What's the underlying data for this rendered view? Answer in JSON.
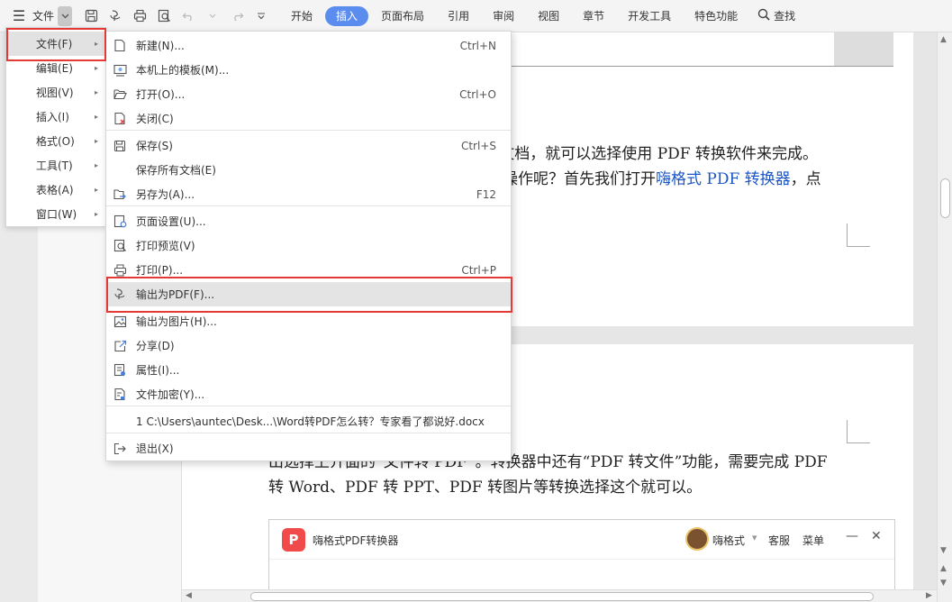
{
  "toolbar": {
    "file_label": "文件",
    "tabs": [
      {
        "label": "开始",
        "active": false
      },
      {
        "label": "插入",
        "active": true
      },
      {
        "label": "页面布局",
        "active": false
      },
      {
        "label": "引用",
        "active": false
      },
      {
        "label": "审阅",
        "active": false
      },
      {
        "label": "视图",
        "active": false
      },
      {
        "label": "章节",
        "active": false
      },
      {
        "label": "开发工具",
        "active": false
      },
      {
        "label": "特色功能",
        "active": false
      }
    ],
    "search_label": "查找",
    "accent_color": "#5b8def"
  },
  "main_menu": {
    "items": [
      {
        "label": "文件(F)",
        "highlighted": true
      },
      {
        "label": "编辑(E)"
      },
      {
        "label": "视图(V)"
      },
      {
        "label": "插入(I)"
      },
      {
        "label": "格式(O)"
      },
      {
        "label": "工具(T)"
      },
      {
        "label": "表格(A)"
      },
      {
        "label": "窗口(W)"
      }
    ]
  },
  "file_submenu": {
    "items": [
      {
        "label": "新建(N)...",
        "shortcut": "Ctrl+N",
        "icon": "new-doc-icon"
      },
      {
        "label": "本机上的模板(M)...",
        "shortcut": "",
        "icon": "template-icon"
      },
      {
        "label": "打开(O)...",
        "shortcut": "Ctrl+O",
        "icon": "folder-open-icon"
      },
      {
        "label": "关闭(C)",
        "shortcut": "",
        "icon": "close-doc-icon"
      },
      {
        "label": "保存(S)",
        "shortcut": "Ctrl+S",
        "icon": "save-icon"
      },
      {
        "label": "保存所有文档(E)",
        "shortcut": "",
        "icon": ""
      },
      {
        "label": "另存为(A)...",
        "shortcut": "F12",
        "icon": "save-as-icon"
      },
      {
        "label": "页面设置(U)...",
        "shortcut": "",
        "icon": "page-setup-icon"
      },
      {
        "label": "打印预览(V)",
        "shortcut": "",
        "icon": "print-preview-icon"
      },
      {
        "label": "打印(P)...",
        "shortcut": "Ctrl+P",
        "icon": "printer-icon"
      },
      {
        "label": "输出为PDF(F)...",
        "shortcut": "",
        "icon": "export-pdf-icon",
        "highlighted": true
      },
      {
        "label": "输出为图片(H)...",
        "shortcut": "",
        "icon": "export-image-icon"
      },
      {
        "label": "分享(D)",
        "shortcut": "",
        "icon": "share-icon"
      },
      {
        "label": "属性(I)...",
        "shortcut": "",
        "icon": "properties-icon"
      },
      {
        "label": "文件加密(Y)...",
        "shortcut": "",
        "icon": "encrypt-icon"
      },
      {
        "label": "1 C:\\Users\\auntec\\Desk...\\Word转PDF怎么转？专家看了都说好.docx",
        "shortcut": "",
        "icon": ""
      },
      {
        "label": "退出(X)",
        "shortcut": "",
        "icon": "exit-icon"
      }
    ]
  },
  "document": {
    "line1": "d 文档，就可以选择使用 PDF 转换软件来完成。",
    "line2_a": "操作呢？首先我们打开",
    "line2_link": "嗨格式 PDF 转换器",
    "line2_b": "，点",
    "line3": "出选择上介面的“文件转 PDF”。转换器中还有“PDF 转文件”功能，需要完成 PDF",
    "line4": "转 Word、PDF 转 PPT、PDF 转图片等转换选择这个就可以。",
    "link_color": "#1a56c8"
  },
  "embedded_app": {
    "logo_glyph": "P",
    "title": "嗨格式PDF转换器",
    "user_name": "嗨格式",
    "service_label": "客服",
    "menu_label": "菜单",
    "logo_color": "#f04a4a"
  },
  "annotations": {
    "highlight_color": "#e53935"
  }
}
